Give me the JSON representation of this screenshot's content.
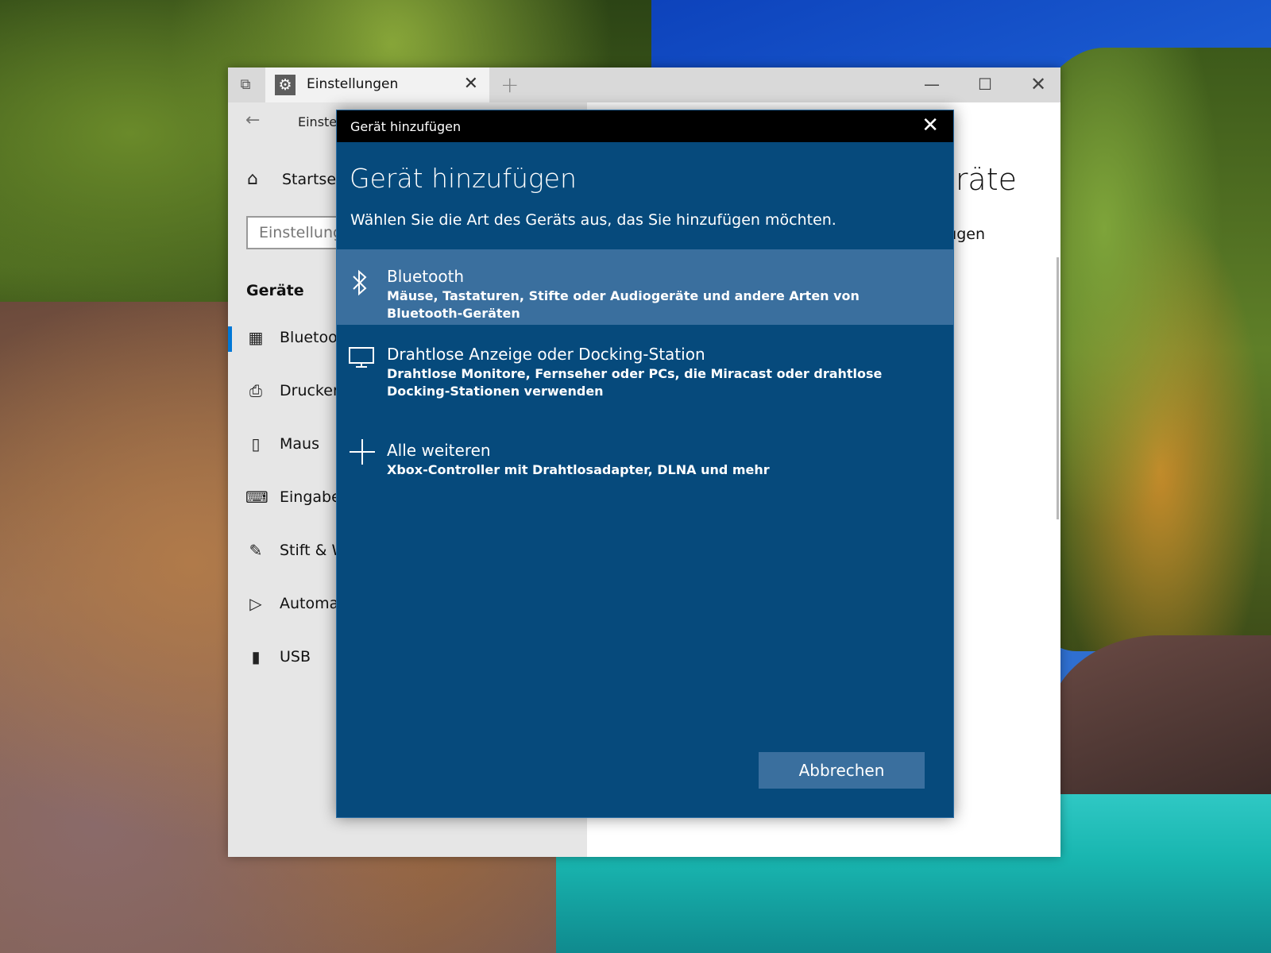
{
  "window": {
    "tab_title": "Einstellungen",
    "tab_close": "✕",
    "new_tab": "+",
    "minimize": "—",
    "maximize": "☐",
    "close": "✕"
  },
  "settings": {
    "back_arrow": "←",
    "breadcrumb": "Einstel",
    "home_label": "Startsei",
    "search_placeholder": "Einstellung",
    "section_title": "Geräte",
    "nav_items": [
      {
        "label": "Bluetoo",
        "icon": "bluetooth-devices-icon"
      },
      {
        "label": "Drucker",
        "icon": "printer-icon"
      },
      {
        "label": "Maus",
        "icon": "mouse-icon"
      },
      {
        "label": "Eingabe",
        "icon": "keyboard-icon"
      },
      {
        "label": "Stift & W",
        "icon": "pen-icon"
      },
      {
        "label": "Automa",
        "icon": "autoplay-icon"
      },
      {
        "label": "USB",
        "icon": "usb-icon"
      }
    ],
    "content_heading": "räte",
    "content_sub": "fügen"
  },
  "dialog": {
    "title": "Gerät hinzufügen",
    "close": "✕",
    "heading": "Gerät hinzufügen",
    "subtitle": "Wählen Sie die Art des Geräts aus, das Sie hinzufügen möchten.",
    "options": [
      {
        "name": "Bluetooth",
        "description": "Mäuse, Tastaturen, Stifte oder Audiogeräte und andere Arten von Bluetooth-Geräten",
        "icon": "bluetooth-icon",
        "selected": true
      },
      {
        "name": "Drahtlose Anzeige oder Docking-Station",
        "description": "Drahtlose Monitore, Fernseher oder PCs, die Miracast oder drahtlose Docking-Stationen verwenden",
        "icon": "monitor-icon",
        "selected": false
      },
      {
        "name": "Alle weiteren",
        "description": "Xbox-Controller mit Drahtlosadapter, DLNA und mehr",
        "icon": "plus-icon",
        "selected": false
      }
    ],
    "cancel_label": "Abbrechen"
  },
  "colors": {
    "dialog_bg": "#064a7c",
    "selected_bg": "#3a6f9e",
    "accent": "#0078d7"
  }
}
